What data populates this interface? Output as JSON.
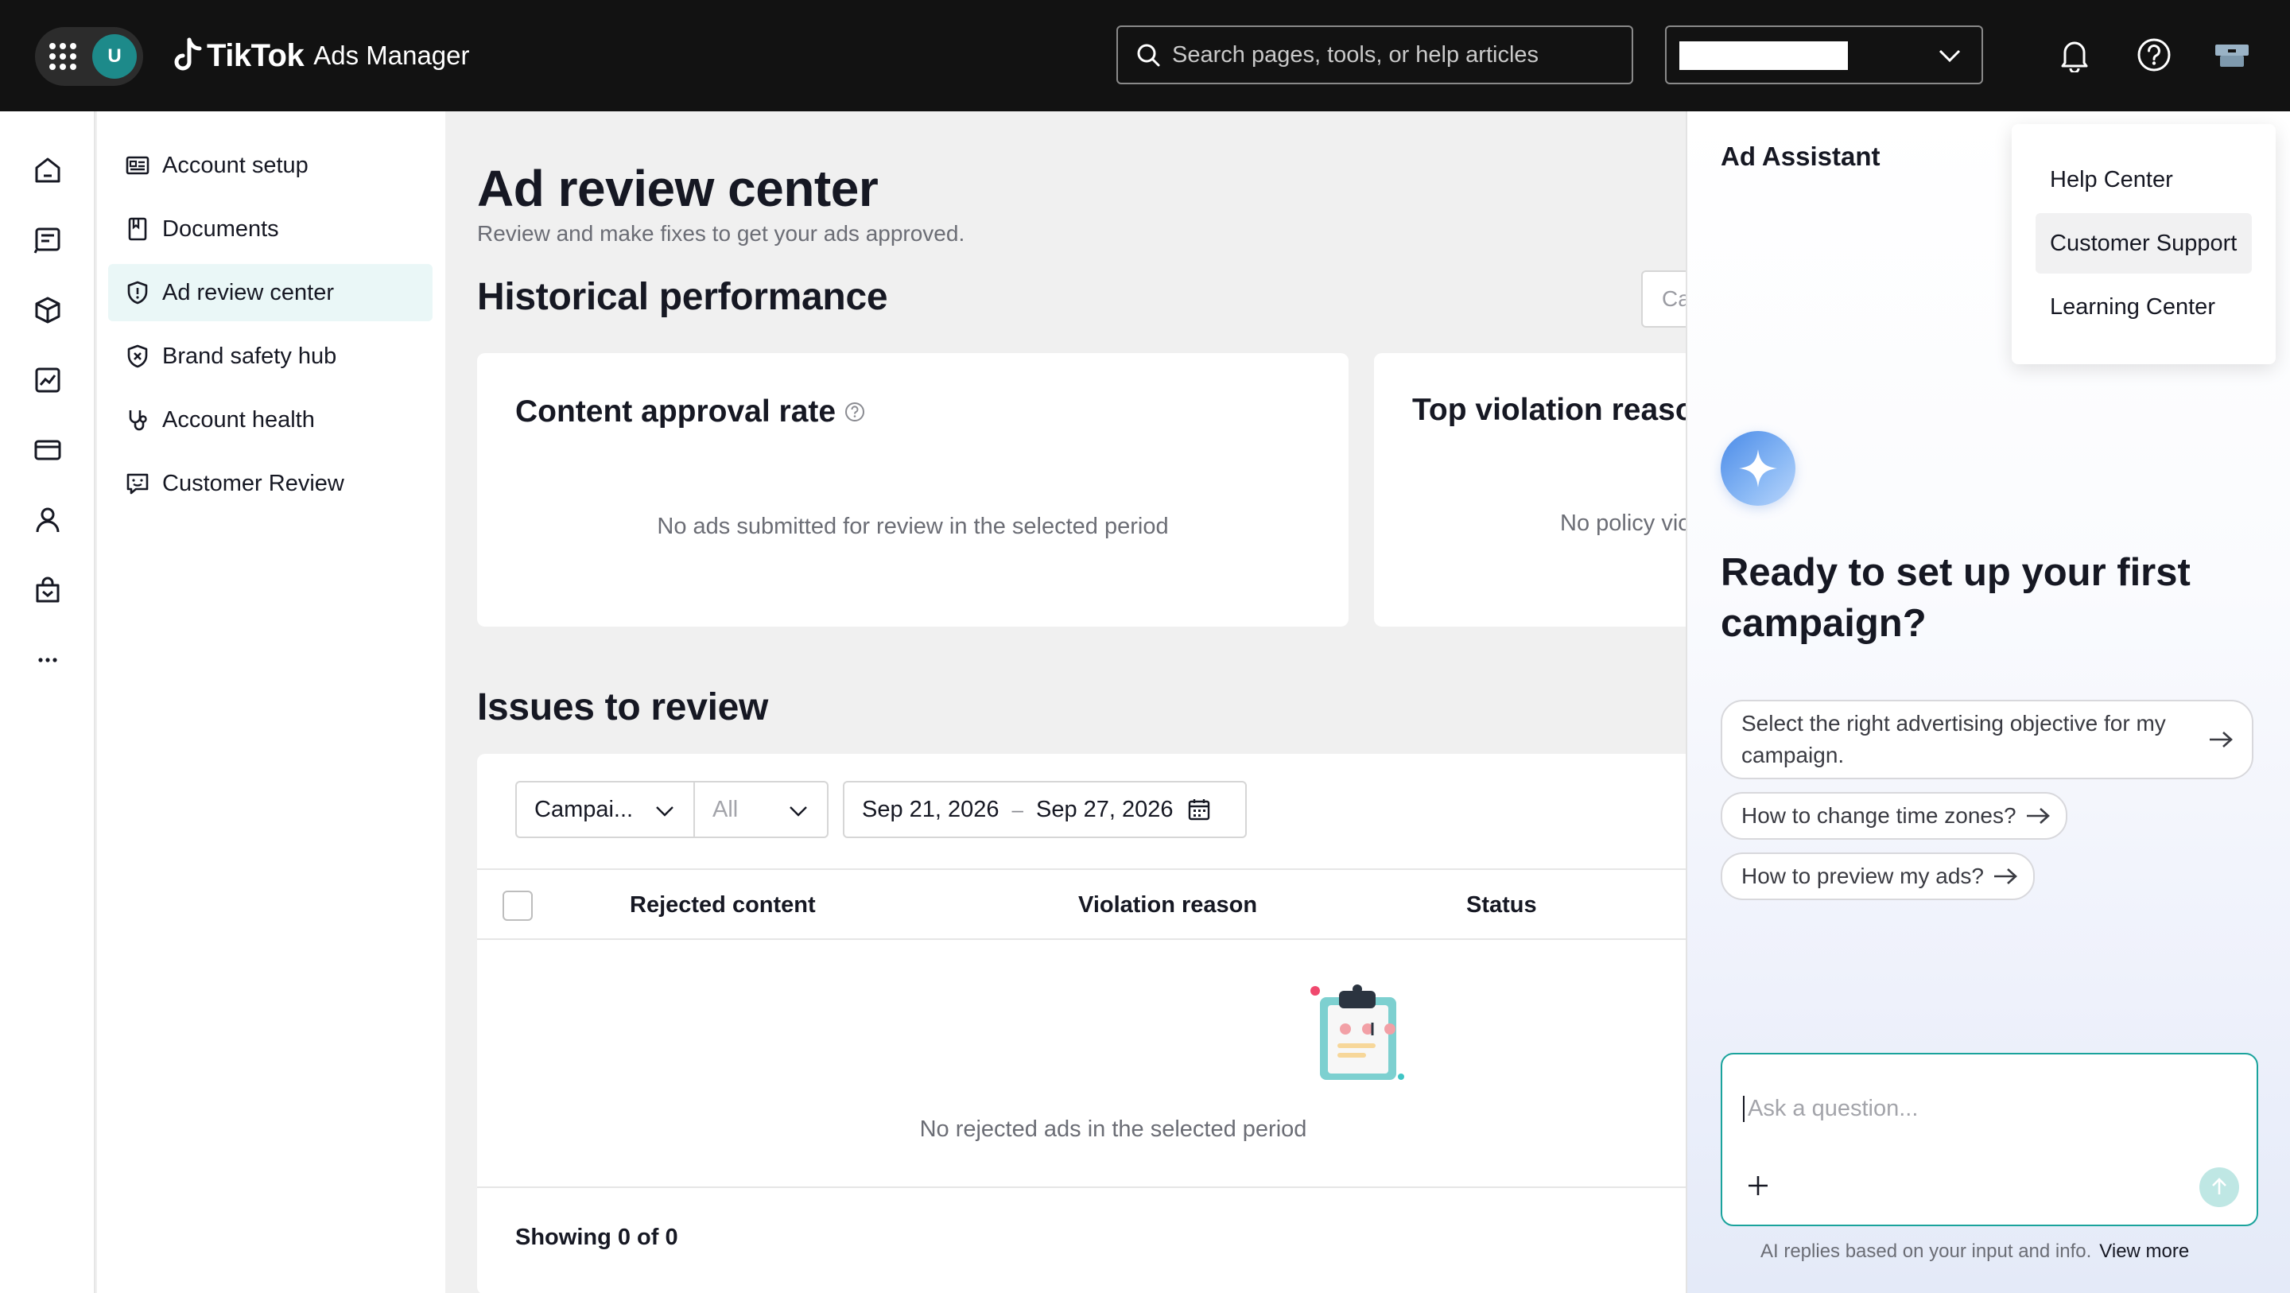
{
  "topbar": {
    "avatar_initial": "U",
    "brand": "TikTok",
    "product": "Ads Manager",
    "search_placeholder": "Search pages, tools, or help articles"
  },
  "sidenav": {
    "items": [
      {
        "label": "Account setup",
        "icon": "id-card-icon"
      },
      {
        "label": "Documents",
        "icon": "bookmark-doc-icon"
      },
      {
        "label": "Ad review center",
        "icon": "shield-info-icon",
        "active": true
      },
      {
        "label": "Brand safety hub",
        "icon": "shield-x-icon"
      },
      {
        "label": "Account health",
        "icon": "stethoscope-icon"
      },
      {
        "label": "Customer Review",
        "icon": "review-message-icon"
      }
    ]
  },
  "main": {
    "title": "Ad review center",
    "subtitle": "Review and make fixes to get your ads approved.",
    "historical_title": "Historical performance",
    "hist_filter_text": "Ca",
    "content_card": {
      "title": "Content approval rate",
      "empty": "No ads submitted for review in the selected period"
    },
    "violation_card": {
      "title": "Top violation reasons",
      "empty": "No policy violations"
    },
    "issues_title": "Issues to review",
    "filters": {
      "campaign": "Campai...",
      "all": "All",
      "date_start": "Sep 21, 2026",
      "date_sep": "–",
      "date_end": "Sep 27, 2026"
    },
    "table": {
      "columns": [
        "Rejected content",
        "Violation reason",
        "Status"
      ],
      "empty": "No rejected ads in the selected period",
      "showing": "Showing 0 of 0"
    }
  },
  "assistant": {
    "title": "Ad Assistant",
    "heading": "Ready to set up your first campaign?",
    "suggestions": [
      "Select the right advertising objective for my campaign.",
      "How to change time zones?",
      "How to preview my ads?"
    ],
    "input_placeholder": "Ask a question...",
    "footer": "AI replies based on your input and info.",
    "footer_link": "View more"
  },
  "help_menu": {
    "items": [
      "Help Center",
      "Customer Support",
      "Learning Center"
    ]
  },
  "colors": {
    "topbar": "#121212",
    "accent": "#1aa39c",
    "active_nav": "#eaf7f7"
  }
}
